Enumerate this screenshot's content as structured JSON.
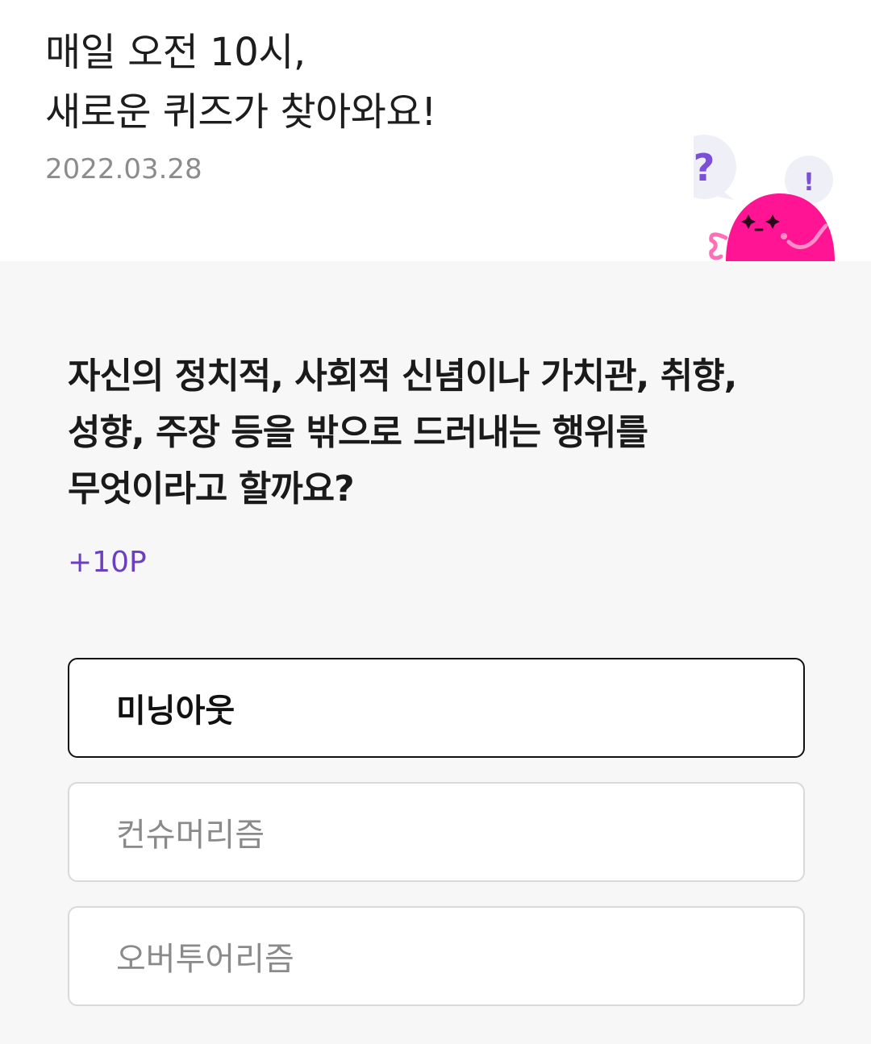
{
  "header": {
    "headline_line1": "매일 오전 10시,",
    "headline_line2": "새로운 퀴즈가 찾아와요!",
    "date": "2022.03.28"
  },
  "mascot": {
    "question_bubble": "?",
    "exclaim_bubble": "!",
    "body_color": "#ff1493",
    "accent_color": "#7b4fd6"
  },
  "quiz": {
    "question": "자신의 정치적, 사회적 신념이나 가치관, 취향, 성향, 주장 등을 밖으로 드러내는 행위를 무엇이라고 할까요?",
    "points": "+10P",
    "options": [
      {
        "label": "미닝아웃",
        "selected": true
      },
      {
        "label": "컨슈머리즘",
        "selected": false
      },
      {
        "label": "오버투어리즘",
        "selected": false
      }
    ]
  }
}
